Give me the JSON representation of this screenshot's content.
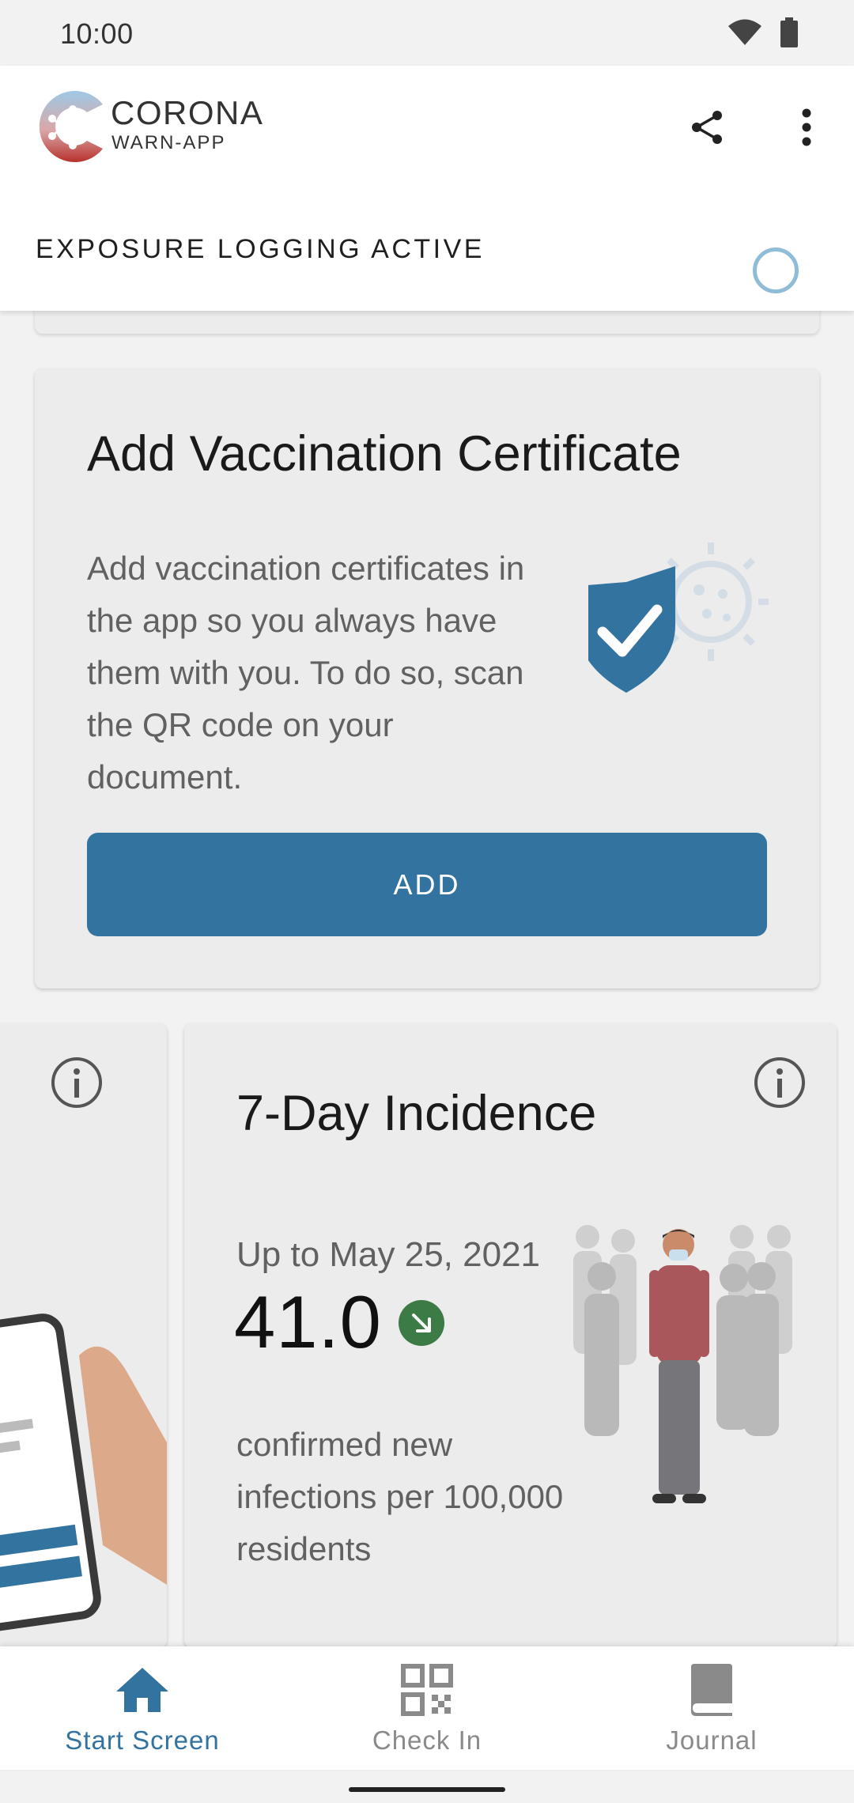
{
  "status_bar": {
    "time": "10:00"
  },
  "header": {
    "logo_line1": "CORONA",
    "logo_line2": "WARN-APP",
    "exposure_status": "EXPOSURE LOGGING ACTIVE"
  },
  "vaccination_card": {
    "title": "Add Vaccination Certificate",
    "body": "Add vaccination certificates in the app so you always have them with you. To do so, scan the QR code on your document.",
    "button_label": "ADD"
  },
  "incidence_card": {
    "title": "7-Day Incidence",
    "date_label": "Up to May 25, 2021",
    "value": "41.0",
    "trend": "down",
    "description": "confirmed new infections per 100,000 residents"
  },
  "bottom_nav": {
    "items": [
      {
        "label": "Start Screen",
        "icon": "home-icon",
        "active": true
      },
      {
        "label": "Check In",
        "icon": "qr-code-icon",
        "active": false
      },
      {
        "label": "Journal",
        "icon": "journal-icon",
        "active": false
      }
    ]
  },
  "colors": {
    "accent": "#32739f",
    "trend_down": "#3c7a46",
    "exposure_ring": "#8fbcd6"
  }
}
